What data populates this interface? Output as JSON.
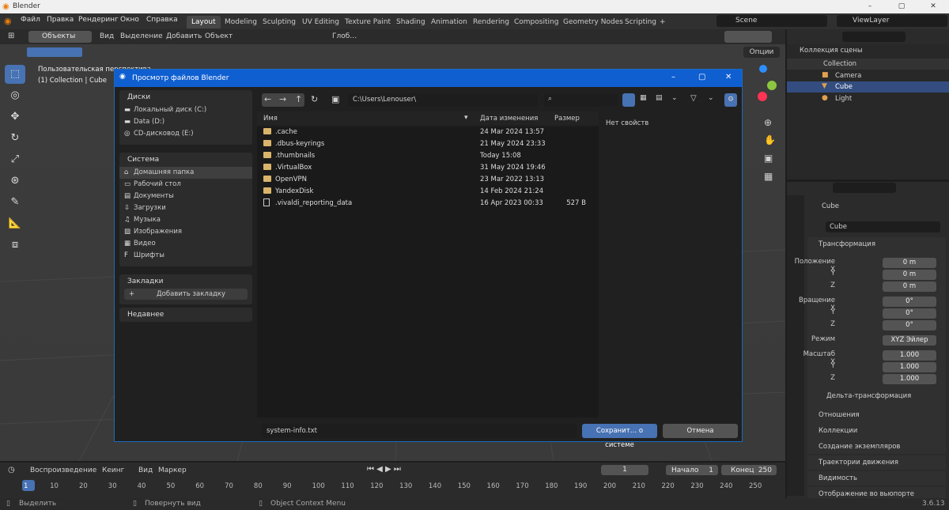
{
  "app": {
    "title": "Blender",
    "win_min": "–",
    "win_max": "▢",
    "win_close": "✕"
  },
  "menu": [
    "Файл",
    "Правка",
    "Рендеринг",
    "Окно",
    "Справка"
  ],
  "workspaces": [
    "Layout",
    "Modeling",
    "Sculpting",
    "UV Editing",
    "Texture Paint",
    "Shading",
    "Animation",
    "Rendering",
    "Compositing",
    "Geometry Nodes",
    "Scripting",
    "+"
  ],
  "scene": "Scene",
  "viewlayer": "ViewLayer",
  "vp_header": {
    "mode": "Объекты",
    "view": "Вид",
    "select": "Выделение",
    "add": "Добавить",
    "object": "Объект",
    "orient": "Глоб…",
    "options": "Опции"
  },
  "viewport": {
    "line1": "Пользовательская перспектива",
    "line2": "(1) Collection | Cube"
  },
  "dialog": {
    "title": "Просмотр файлов Blender",
    "path": "C:\\Users\\Lenouser\\",
    "sections": {
      "drives": {
        "title": "Диски",
        "items": [
          "Локальный диск (C:)",
          "Data (D:)",
          "CD-дисковод (E:)"
        ]
      },
      "system": {
        "title": "Система",
        "items": [
          "Домашняя папка",
          "Рабочий стол",
          "Документы",
          "Загрузки",
          "Музыка",
          "Изображения",
          "Видео",
          "Шрифты"
        ]
      },
      "bookmarks": {
        "title": "Закладки",
        "add": "Добавить закладку"
      },
      "recent": {
        "title": "Недавнее"
      }
    },
    "columns": {
      "name": "Имя",
      "date": "Дата изменения",
      "size": "Размер"
    },
    "files": [
      {
        "name": ".cache",
        "date": "24 Mar 2024 13:57",
        "size": "",
        "type": "folder"
      },
      {
        "name": ".dbus-keyrings",
        "date": "21 May 2024 23:33",
        "size": "",
        "type": "folder"
      },
      {
        "name": ".thumbnails",
        "date": "Today 15:08",
        "size": "",
        "type": "folder"
      },
      {
        "name": ".VirtualBox",
        "date": "31 May 2024 19:46",
        "size": "",
        "type": "folder"
      },
      {
        "name": "OpenVPN",
        "date": "23 Mar 2022 13:13",
        "size": "",
        "type": "folder"
      },
      {
        "name": "YandexDisk",
        "date": "14 Feb 2024 21:24",
        "size": "",
        "type": "folder"
      },
      {
        "name": ".vivaldi_reporting_data",
        "date": "16 Apr 2023 00:33",
        "size": "527 B",
        "type": "file"
      }
    ],
    "no_props": "Нет свойств",
    "filename": "system-info.txt",
    "save": "Сохранит… о системе",
    "cancel": "Отмена"
  },
  "outliner": {
    "title": "Коллекция сцены",
    "items": [
      "Collection",
      "Camera",
      "Cube",
      "Light"
    ]
  },
  "properties": {
    "object": "Cube",
    "data": "Cube",
    "transform": "Трансформация",
    "loc_label": "Положение X",
    "rot_label": "Вращение X",
    "scale_label": "Масштаб X",
    "y": "Y",
    "z": "Z",
    "loc": [
      "0 m",
      "0 m",
      "0 m"
    ],
    "rot": [
      "0°",
      "0°",
      "0°"
    ],
    "scale": [
      "1.000",
      "1.000",
      "1.000"
    ],
    "mode_label": "Режим",
    "mode": "XYZ Эйлер",
    "delta": "Дельта-трансформация",
    "panels": [
      "Отношения",
      "Коллекции",
      "Создание экземпляров",
      "Траектории движения",
      "Видимость",
      "Отображение во вьюпорте"
    ]
  },
  "timeline": {
    "playback": "Воспроизведение",
    "keying": "Кеинг",
    "view": "Вид",
    "marker": "Маркер",
    "frame": "1",
    "start_label": "Начало",
    "start": "1",
    "end_label": "Конец",
    "end": "250",
    "ticks": [
      "1",
      "10",
      "20",
      "30",
      "40",
      "50",
      "60",
      "70",
      "80",
      "90",
      "100",
      "110",
      "120",
      "130",
      "140",
      "150",
      "160",
      "170",
      "180",
      "190",
      "200",
      "210",
      "220",
      "230",
      "240",
      "250"
    ]
  },
  "status": {
    "select": "Выделить",
    "rotate": "Повернуть вид",
    "context": "Object Context Menu",
    "version": "3.6.13"
  }
}
